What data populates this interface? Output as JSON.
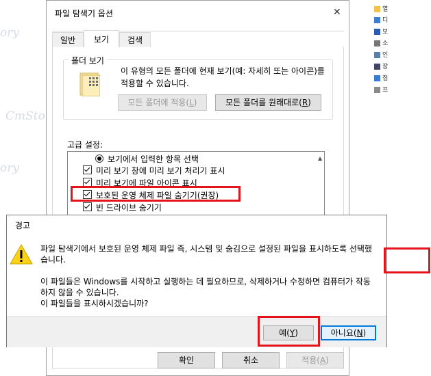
{
  "background": {
    "watermarks": [
      "ory",
      "CmSto",
      "ory"
    ],
    "right_items": [
      "열",
      "디",
      "보",
      "소",
      "인",
      "장",
      "접",
      "프"
    ]
  },
  "folder_options": {
    "title": "파일 탐색기 옵션",
    "close_glyph": "✕",
    "tabs": [
      {
        "label": "일반"
      },
      {
        "label": "보기"
      },
      {
        "label": "검색"
      }
    ],
    "folder_view": {
      "legend": "폴더 보기",
      "description": "이 유형의 모든 폴더에 현재 보기(예: 자세히 또는 아이콘)를 적용할 수 있습니다.",
      "apply_label": "모든 폴더에 적용",
      "apply_key": "L",
      "reset_label": "모든 폴더를 원래대로",
      "reset_key": "R"
    },
    "advanced": {
      "label": "고급 설정:",
      "items": [
        {
          "label": "보기에서 입력한 항목 선택",
          "type": "radio",
          "checked": true
        },
        {
          "label": "미리 보기 창에 미리 보기 처리기 표시",
          "type": "checkbox",
          "checked": true
        },
        {
          "label": "미리 보기에 파일 아이콘 표시",
          "type": "checkbox",
          "checked": true
        },
        {
          "label": "보호된 운영 체제 파일 숨기기(권장)",
          "type": "checkbox",
          "checked": true
        },
        {
          "label": "빈 드라이브 숨기기",
          "type": "checkbox",
          "checked": true
        }
      ]
    },
    "footer": {
      "ok": "확인",
      "cancel": "취소",
      "apply": "적용",
      "apply_key": "A"
    }
  },
  "warning": {
    "title": "경고",
    "message_line1": "파일 탐색기에서 보호된 운영 체제 파일 즉, 시스템 및 숨김으로 설정된 파일을 표시하도록 선택했습니다.",
    "message_line2": "이 파일들은 Windows를 시작하고 실행하는 데 필요하므로, 삭제하거나 수정하면 컴퓨터가 작동하지 않을 수 있습니다.",
    "message_line3": "이 파일들을 표시하시겠습니까?",
    "yes_label": "예",
    "yes_key": "Y",
    "no_label": "아니요",
    "no_key": "N"
  },
  "colors": {
    "highlight": "#e3121b",
    "focus": "#0078d7"
  }
}
